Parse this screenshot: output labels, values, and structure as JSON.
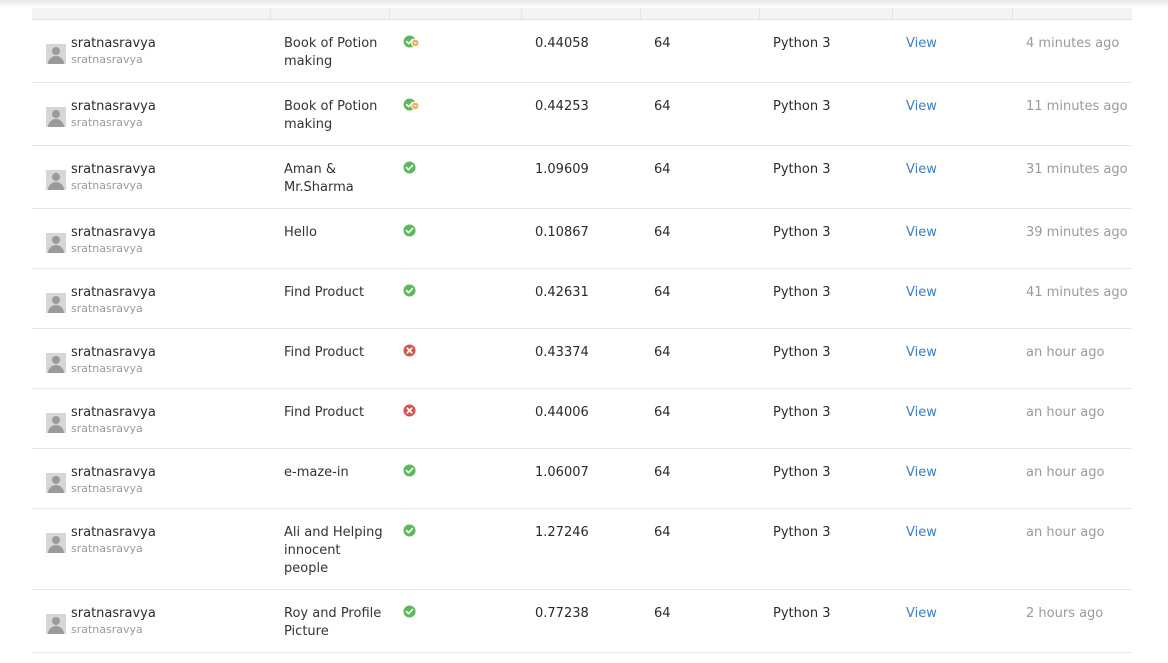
{
  "colors": {
    "accepted": "#5cb85c",
    "wrong": "#d9534f",
    "partial": "#f0ad4e",
    "link": "#3c7fc0"
  },
  "submissions": [
    {
      "user": "sratnasravya",
      "handle": "sratnasravya",
      "problem": "Book of Potion making",
      "status_icon": "partial-check-icon",
      "time": "0.44058",
      "memory": "64",
      "language": "Python 3",
      "view": "View",
      "when": "4 minutes ago"
    },
    {
      "user": "sratnasravya",
      "handle": "sratnasravya",
      "problem": "Book of Potion making",
      "status_icon": "partial-check-icon",
      "time": "0.44253",
      "memory": "64",
      "language": "Python 3",
      "view": "View",
      "when": "11 minutes ago"
    },
    {
      "user": "sratnasravya",
      "handle": "sratnasravya",
      "problem": "Aman & Mr.Sharma",
      "status_icon": "check-circle-icon",
      "time": "1.09609",
      "memory": "64",
      "language": "Python 3",
      "view": "View",
      "when": "31 minutes ago"
    },
    {
      "user": "sratnasravya",
      "handle": "sratnasravya",
      "problem": "Hello",
      "status_icon": "check-circle-icon",
      "time": "0.10867",
      "memory": "64",
      "language": "Python 3",
      "view": "View",
      "when": "39 minutes ago"
    },
    {
      "user": "sratnasravya",
      "handle": "sratnasravya",
      "problem": "Find Product",
      "status_icon": "check-circle-icon",
      "time": "0.42631",
      "memory": "64",
      "language": "Python 3",
      "view": "View",
      "when": "41 minutes ago"
    },
    {
      "user": "sratnasravya",
      "handle": "sratnasravya",
      "problem": "Find Product",
      "status_icon": "x-circle-icon",
      "time": "0.43374",
      "memory": "64",
      "language": "Python 3",
      "view": "View",
      "when": "an hour ago"
    },
    {
      "user": "sratnasravya",
      "handle": "sratnasravya",
      "problem": "Find Product",
      "status_icon": "x-circle-icon",
      "time": "0.44006",
      "memory": "64",
      "language": "Python 3",
      "view": "View",
      "when": "an hour ago"
    },
    {
      "user": "sratnasravya",
      "handle": "sratnasravya",
      "problem": "e-maze-in",
      "status_icon": "check-circle-icon",
      "time": "1.06007",
      "memory": "64",
      "language": "Python 3",
      "view": "View",
      "when": "an hour ago"
    },
    {
      "user": "sratnasravya",
      "handle": "sratnasravya",
      "problem": "Ali and Helping innocent people",
      "status_icon": "check-circle-icon",
      "time": "1.27246",
      "memory": "64",
      "language": "Python 3",
      "view": "View",
      "when": "an hour ago"
    },
    {
      "user": "sratnasravya",
      "handle": "sratnasravya",
      "problem": "Roy and Profile Picture",
      "status_icon": "check-circle-icon",
      "time": "0.77238",
      "memory": "64",
      "language": "Python 3",
      "view": "View",
      "when": "2 hours ago"
    }
  ]
}
